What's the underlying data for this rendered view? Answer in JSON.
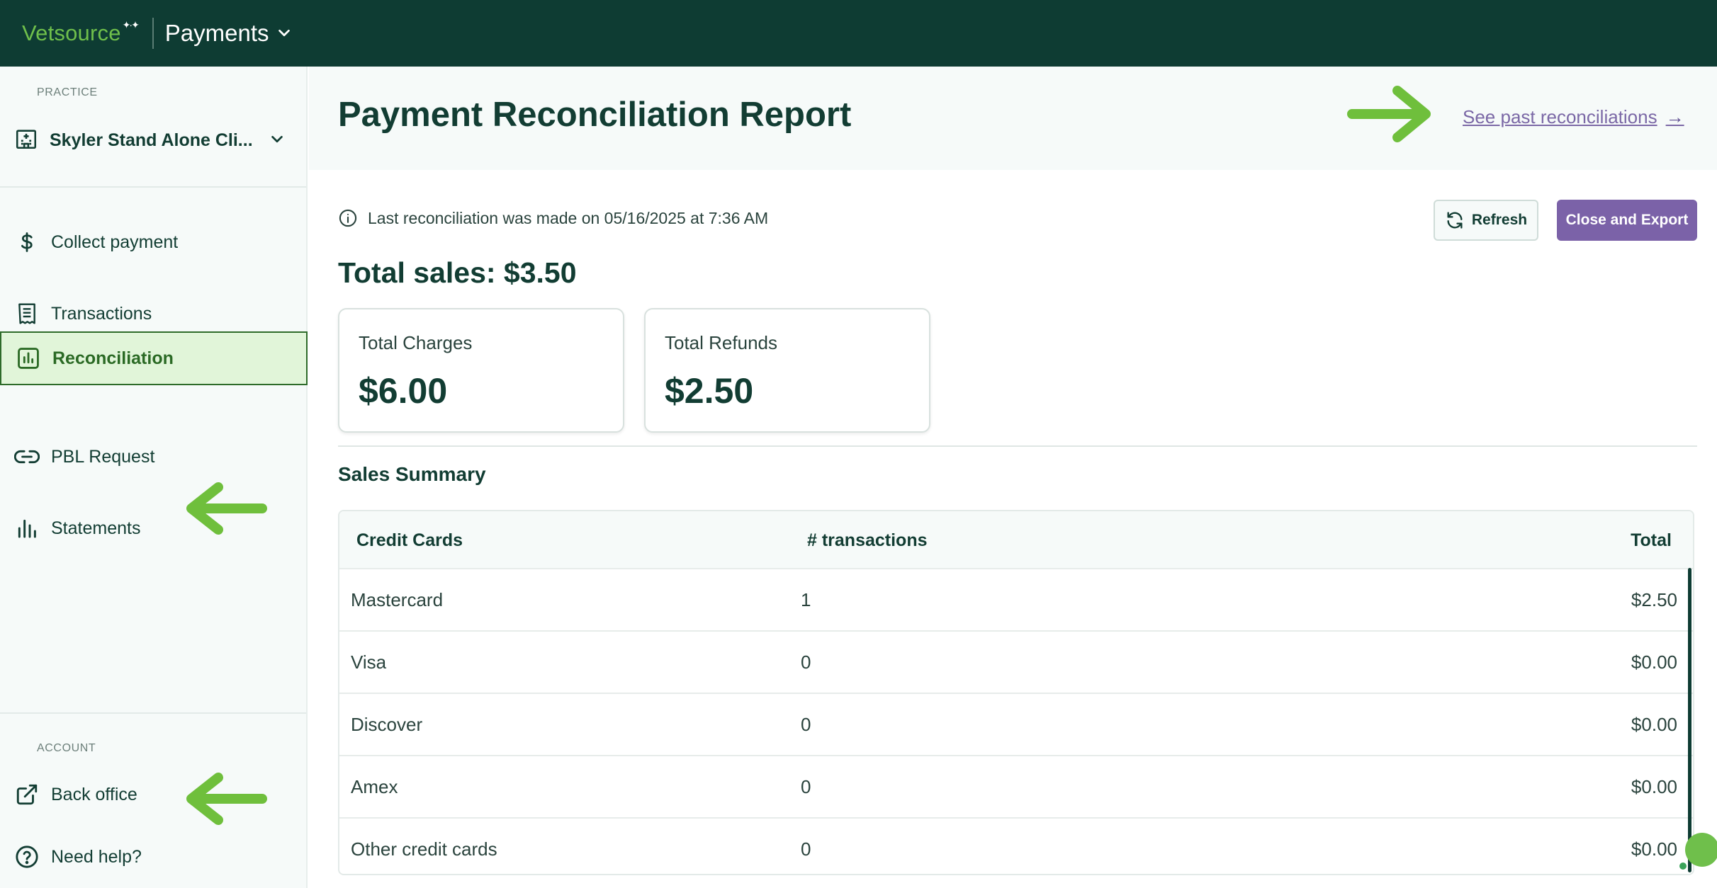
{
  "topbar": {
    "brand": "Vetsource",
    "app_name": "Payments"
  },
  "sidebar": {
    "practice_label": "PRACTICE",
    "practice_name": "Skyler Stand Alone Cli...",
    "items": [
      {
        "label": "Collect payment",
        "icon": "dollar-icon"
      },
      {
        "label": "Transactions",
        "icon": "receipt-icon"
      },
      {
        "label": "Reconciliation",
        "icon": "bar-chart-box-icon",
        "active": true
      },
      {
        "label": "PBL Request",
        "icon": "link-icon"
      },
      {
        "label": "Statements",
        "icon": "bar-chart-icon"
      }
    ],
    "account_label": "ACCOUNT",
    "account_items": [
      {
        "label": "Back office",
        "icon": "external-link-icon"
      },
      {
        "label": "Need help?",
        "icon": "help-circle-icon"
      }
    ]
  },
  "main": {
    "title": "Payment Reconciliation Report",
    "past_link": "See past reconciliations",
    "info": "Last reconciliation was made on 05/16/2025 at 7:36 AM",
    "refresh_label": "Refresh",
    "export_label": "Close and Export",
    "total_sales": "Total sales: $3.50",
    "cards": [
      {
        "label": "Total Charges",
        "value": "$6.00"
      },
      {
        "label": "Total Refunds",
        "value": "$2.50"
      }
    ],
    "section_title": "Sales Summary",
    "table": {
      "headers": [
        "Credit Cards",
        "# transactions",
        "Total"
      ],
      "rows": [
        [
          "Mastercard",
          "1",
          "$2.50"
        ],
        [
          "Visa",
          "0",
          "$0.00"
        ],
        [
          "Discover",
          "0",
          "$0.00"
        ],
        [
          "Amex",
          "0",
          "$0.00"
        ],
        [
          "Other credit cards",
          "0",
          "$0.00"
        ]
      ]
    }
  },
  "colors": {
    "topbar": "#0e3c33",
    "brand_green": "#6fbf4b",
    "accent_purple": "#7b62a8",
    "active_bg": "#e1f5d9",
    "annotation_arrow": "#6fbf3c"
  }
}
